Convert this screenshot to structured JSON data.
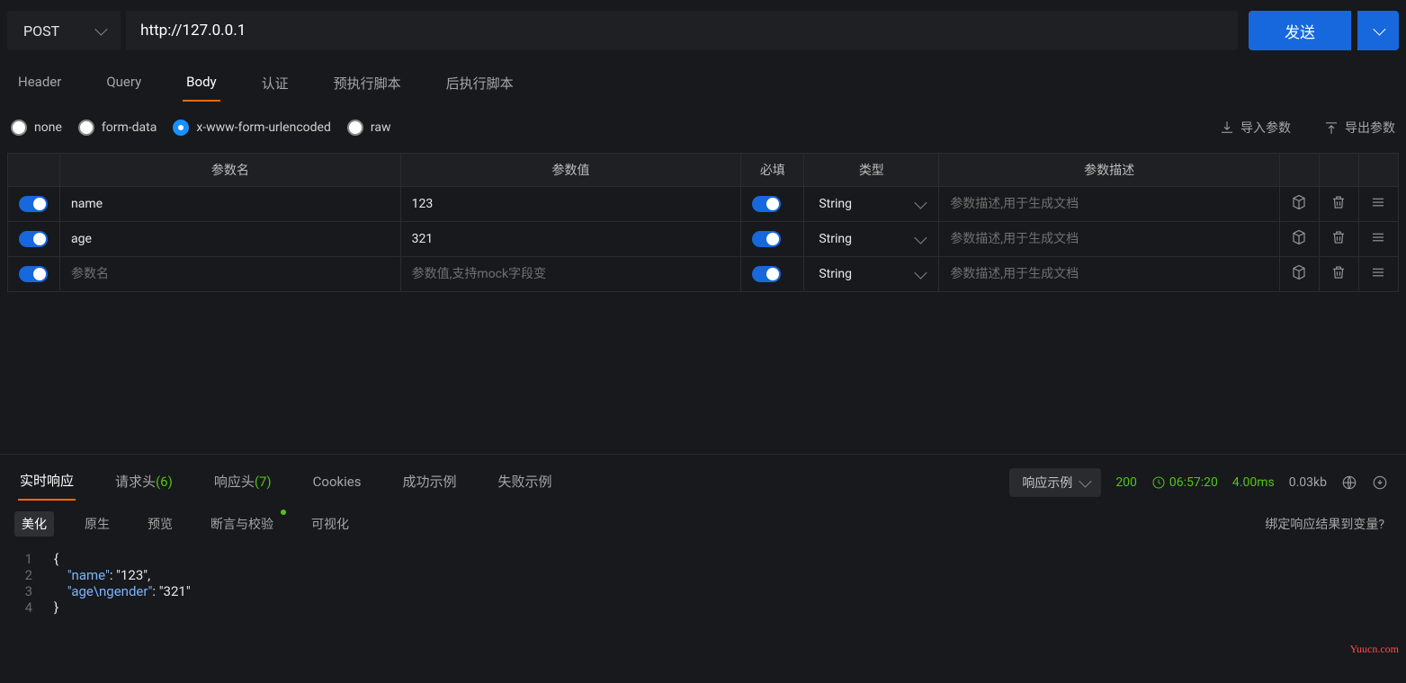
{
  "request": {
    "method": "POST",
    "url": "http://127.0.0.1",
    "send_label": "发送"
  },
  "req_tabs": [
    "Header",
    "Query",
    "Body",
    "认证",
    "预执行脚本",
    "后执行脚本"
  ],
  "req_tab_active": "Body",
  "body_types": [
    {
      "id": "none",
      "label": "none",
      "selected": false
    },
    {
      "id": "form-data",
      "label": "form-data",
      "selected": false
    },
    {
      "id": "urlenc",
      "label": "x-www-form-urlencoded",
      "selected": true
    },
    {
      "id": "raw",
      "label": "raw",
      "selected": false
    }
  ],
  "io": {
    "import": "导入参数",
    "export": "导出参数"
  },
  "param_headers": {
    "name": "参数名",
    "value": "参数值",
    "required": "必填",
    "type": "类型",
    "desc": "参数描述"
  },
  "param_placeholders": {
    "name": "参数名",
    "value": "参数值,支持mock字段变",
    "desc": "参数描述,用于生成文档"
  },
  "params": [
    {
      "enabled": true,
      "name": "name",
      "value": "123",
      "required": true,
      "type": "String",
      "desc": ""
    },
    {
      "enabled": true,
      "name": "age",
      "value": "321",
      "required": true,
      "type": "String",
      "desc": ""
    },
    {
      "enabled": true,
      "name": "",
      "value": "",
      "required": true,
      "type": "String",
      "desc": ""
    }
  ],
  "resp_tabs": [
    {
      "label": "实时响应",
      "count": null,
      "active": true
    },
    {
      "label": "请求头",
      "count": "(6)",
      "active": false
    },
    {
      "label": "响应头",
      "count": "(7)",
      "active": false
    },
    {
      "label": "Cookies",
      "count": null,
      "active": false
    },
    {
      "label": "成功示例",
      "count": null,
      "active": false
    },
    {
      "label": "失败示例",
      "count": null,
      "active": false
    }
  ],
  "resp_meta": {
    "example_label": "响应示例",
    "status": "200",
    "time": "06:57:20",
    "latency": "4.00ms",
    "size": "0.03kb"
  },
  "fmt_tabs": [
    "美化",
    "原生",
    "预览",
    "断言与校验",
    "可视化"
  ],
  "fmt_active": "美化",
  "assert_has_dot": true,
  "bind_link": "绑定响应结果到变量?",
  "code_lines": [
    {
      "n": 1,
      "raw": "{"
    },
    {
      "n": 2,
      "raw": "    \"name\": \"123\","
    },
    {
      "n": 3,
      "raw": "    \"age\\ngender\": \"321\""
    },
    {
      "n": 4,
      "raw": "}"
    }
  ],
  "watermark": "Yuucn.com"
}
